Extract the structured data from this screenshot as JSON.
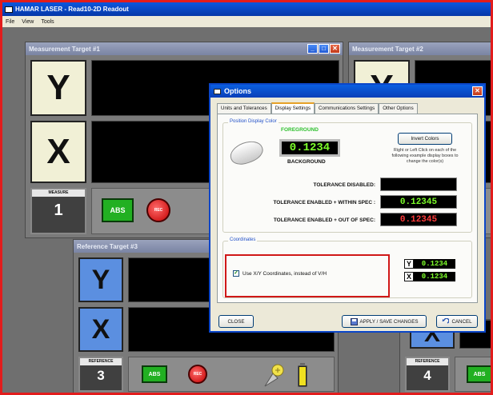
{
  "app": {
    "title": "HAMAR LASER - Read10-2D Readout",
    "menu": [
      "File",
      "View",
      "Tools"
    ]
  },
  "windows": {
    "target1": {
      "title": "Measurement Target #1",
      "y_label": "Y",
      "x_label": "X",
      "measure_label": "MEASURE",
      "measure_num": "1",
      "abs_label": "ABS",
      "rec_label": "REC"
    },
    "target2": {
      "title": "Measurement Target #2",
      "y_label": "Y",
      "x_label": "X"
    },
    "target3": {
      "title": "Reference Target #3",
      "y_label": "Y",
      "x_label": "X",
      "measure_label": "REFERENCE",
      "measure_num": "3",
      "abs_label": "ABS",
      "rec_label": "REC"
    },
    "target4": {
      "x_label": "X",
      "measure_label": "REFERENCE",
      "measure_num": "4",
      "abs_label": "ABS"
    }
  },
  "dialog": {
    "title": "Options",
    "tabs": [
      "Units and Tolerances",
      "Display Settings",
      "Communications Settings",
      "Other Options"
    ],
    "active_tab": "Display Settings",
    "position_group": {
      "legend": "Position Display Color",
      "foreground_label": "FOREGROUND",
      "background_label": "BACKGROUND",
      "sample_value": "0.1234",
      "invert_button": "Invert Colors",
      "instructions": "Right or Left Click on each of the following example display boxes to change the color(s)",
      "tolerance_disabled_label": "TOLERANCE DISABLED:",
      "tolerance_within_label": "TOLERANCE ENABLED + WITHIN SPEC :",
      "tolerance_within_value": "0.12345",
      "tolerance_out_label": "TOLERANCE ENABLED + OUT OF SPEC:",
      "tolerance_out_value": "0.12345"
    },
    "coords_group": {
      "legend": "Coordinates",
      "checkbox_label": "Use X/Y Coordinates, instead of V/H",
      "checkbox_checked": true,
      "y_letter": "Y",
      "y_value": "0.1234",
      "x_letter": "X",
      "x_value": "0.1234"
    },
    "buttons": {
      "close": "CLOSE",
      "apply": "APPLY / SAVE CHANGES",
      "cancel": "CANCEL"
    }
  },
  "colors": {
    "foreground_green": "#7dff2a",
    "out_of_spec_red": "#ff3b3b",
    "highlight_red": "#d01818"
  }
}
